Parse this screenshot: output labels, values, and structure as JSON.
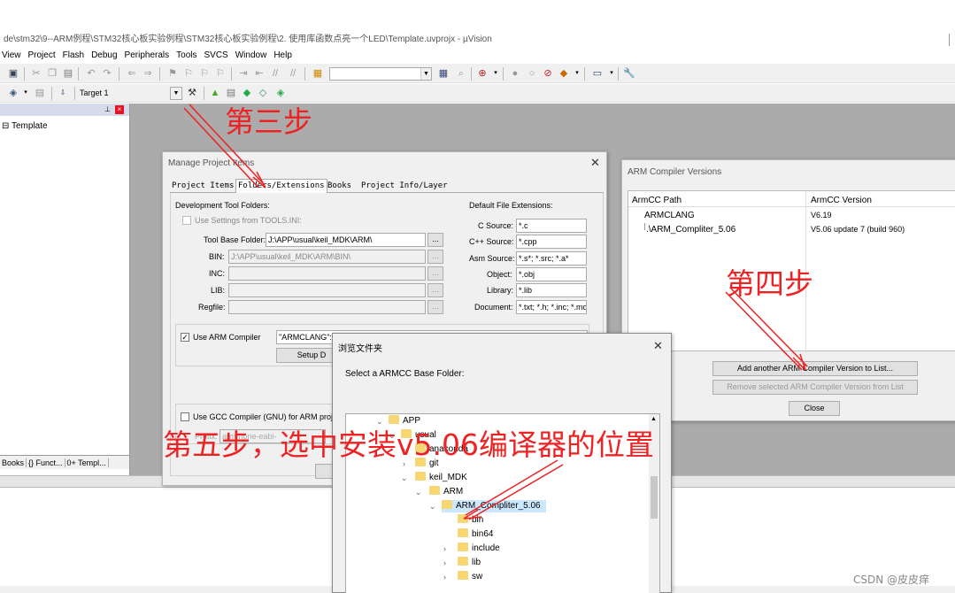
{
  "window": {
    "title": "de\\stm32\\9--ARM例程\\STM32核心板实验例程\\STM32核心板实验例程\\2. 使用库函数点亮一个LED\\Template.uvprojx - µVision"
  },
  "menu": [
    "View",
    "Project",
    "Flash",
    "Debug",
    "Peripherals",
    "Tools",
    "SVCS",
    "Window",
    "Help"
  ],
  "toolbar": {
    "target": "Target 1"
  },
  "project_panel": {
    "root": "Template",
    "tabs": [
      "Books",
      "{} Funct...",
      "0+ Templ..."
    ]
  },
  "manage_dialog": {
    "title": "Manage Project Items",
    "tabs": [
      "Project Items",
      "Folders/Extensions",
      "Books",
      "Project Info/Layer"
    ],
    "dev_tool_folders": "Development Tool Folders:",
    "use_settings": "Use Settings from TOOLS.INI:",
    "tool_base_label": "Tool Base Folder:",
    "tool_base_value": "J:\\APP\\usual\\keil_MDK\\ARM\\",
    "bin_label": "BIN:",
    "bin_value": "J:\\APP\\usual\\keil_MDK\\ARM\\BIN\\",
    "inc_label": "INC:",
    "lib_label": "LIB:",
    "regfile_label": "Regfile:",
    "default_ext": "Default File Extensions:",
    "ext": [
      {
        "label": "C Source:",
        "value": "*.c"
      },
      {
        "label": "C++ Source:",
        "value": "*.cpp"
      },
      {
        "label": "Asm Source:",
        "value": "*.s*; *.src; *.a*"
      },
      {
        "label": "Object:",
        "value": "*.obj"
      },
      {
        "label": "Library:",
        "value": "*.lib"
      },
      {
        "label": "Document:",
        "value": "*.txt; *.h; *.inc; *.md"
      }
    ],
    "use_arm_compiler": "Use ARM Compiler",
    "arm_compiler_value": "\"ARMCLANG\": V6.19 ...",
    "setup_btn": "Setup D",
    "use_gcc": "Use GCC Compiler (GNU) for ARM project",
    "prefix_label": "Prefix:",
    "prefix_value": "arm-none-eabi-",
    "dots": "..."
  },
  "compiler_dialog": {
    "title": "ARM Compiler Versions",
    "col_path": "ArmCC Path",
    "col_version": "ArmCC Version",
    "rows": [
      {
        "path": "ARMCLANG",
        "version": "V6.19"
      },
      {
        "path": ".\\ARM_Compliter_5.06",
        "version": "V5.06 update 7 (build 960)"
      }
    ],
    "add_btn": "Add another ARM Compiler Version to List...",
    "remove_btn": "Remove selected ARM Compiler Version from List",
    "close_btn": "Close"
  },
  "browse_dialog": {
    "title": "浏览文件夹",
    "prompt": "Select a ARMCC Base Folder:",
    "tree": [
      "APP",
      "usual",
      "anaconda",
      "git",
      "keil_MDK",
      "ARM",
      "ARM_Compliter_5.06",
      "bin",
      "bin64",
      "include",
      "lib",
      "sw"
    ]
  },
  "annotations": {
    "step3": "第三步",
    "step4": "第四步",
    "step5": "第五步，选中安装v5.06编译器的位置"
  },
  "watermark": "CSDN @皮皮痒",
  "colors": {
    "annotation": "#e22222",
    "workspace": "#ababab",
    "selected": "#cce8ff"
  }
}
